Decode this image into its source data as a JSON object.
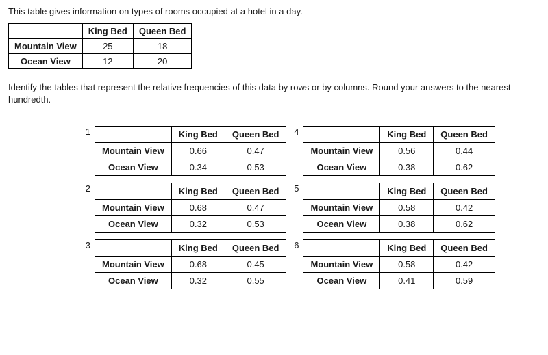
{
  "intro": "This table gives information on types of rooms occupied at a hotel in a day.",
  "headers": {
    "col1": "King Bed",
    "col2": "Queen Bed"
  },
  "rows": {
    "r1": {
      "label": "Mountain View"
    },
    "r2": {
      "label": "Ocean View"
    }
  },
  "main": {
    "r1c1": "25",
    "r1c2": "18",
    "r2c1": "12",
    "r2c2": "20"
  },
  "question": "Identify the tables that represent the relative frequencies of this data by rows or by columns. Round your answers to the nearest hundredth.",
  "options": {
    "o1": {
      "num": "1",
      "r1c1": "0.66",
      "r1c2": "0.47",
      "r2c1": "0.34",
      "r2c2": "0.53"
    },
    "o2": {
      "num": "2",
      "r1c1": "0.68",
      "r1c2": "0.47",
      "r2c1": "0.32",
      "r2c2": "0.53"
    },
    "o3": {
      "num": "3",
      "r1c1": "0.68",
      "r1c2": "0.45",
      "r2c1": "0.32",
      "r2c2": "0.55"
    },
    "o4": {
      "num": "4",
      "r1c1": "0.56",
      "r1c2": "0.44",
      "r2c1": "0.38",
      "r2c2": "0.62"
    },
    "o5": {
      "num": "5",
      "r1c1": "0.58",
      "r1c2": "0.42",
      "r2c1": "0.38",
      "r2c2": "0.62"
    },
    "o6": {
      "num": "6",
      "r1c1": "0.58",
      "r1c2": "0.42",
      "r2c1": "0.41",
      "r2c2": "0.59"
    }
  }
}
